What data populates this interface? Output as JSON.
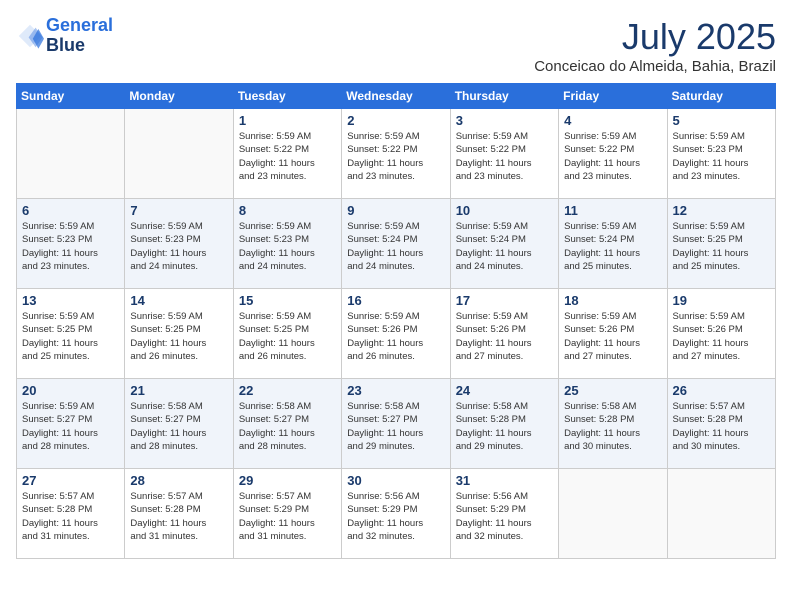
{
  "header": {
    "logo_line1": "General",
    "logo_line2": "Blue",
    "month": "July 2025",
    "location": "Conceicao do Almeida, Bahia, Brazil"
  },
  "days_of_week": [
    "Sunday",
    "Monday",
    "Tuesday",
    "Wednesday",
    "Thursday",
    "Friday",
    "Saturday"
  ],
  "weeks": [
    [
      {
        "num": "",
        "info": ""
      },
      {
        "num": "",
        "info": ""
      },
      {
        "num": "1",
        "info": "Sunrise: 5:59 AM\nSunset: 5:22 PM\nDaylight: 11 hours\nand 23 minutes."
      },
      {
        "num": "2",
        "info": "Sunrise: 5:59 AM\nSunset: 5:22 PM\nDaylight: 11 hours\nand 23 minutes."
      },
      {
        "num": "3",
        "info": "Sunrise: 5:59 AM\nSunset: 5:22 PM\nDaylight: 11 hours\nand 23 minutes."
      },
      {
        "num": "4",
        "info": "Sunrise: 5:59 AM\nSunset: 5:22 PM\nDaylight: 11 hours\nand 23 minutes."
      },
      {
        "num": "5",
        "info": "Sunrise: 5:59 AM\nSunset: 5:23 PM\nDaylight: 11 hours\nand 23 minutes."
      }
    ],
    [
      {
        "num": "6",
        "info": "Sunrise: 5:59 AM\nSunset: 5:23 PM\nDaylight: 11 hours\nand 23 minutes."
      },
      {
        "num": "7",
        "info": "Sunrise: 5:59 AM\nSunset: 5:23 PM\nDaylight: 11 hours\nand 24 minutes."
      },
      {
        "num": "8",
        "info": "Sunrise: 5:59 AM\nSunset: 5:23 PM\nDaylight: 11 hours\nand 24 minutes."
      },
      {
        "num": "9",
        "info": "Sunrise: 5:59 AM\nSunset: 5:24 PM\nDaylight: 11 hours\nand 24 minutes."
      },
      {
        "num": "10",
        "info": "Sunrise: 5:59 AM\nSunset: 5:24 PM\nDaylight: 11 hours\nand 24 minutes."
      },
      {
        "num": "11",
        "info": "Sunrise: 5:59 AM\nSunset: 5:24 PM\nDaylight: 11 hours\nand 25 minutes."
      },
      {
        "num": "12",
        "info": "Sunrise: 5:59 AM\nSunset: 5:25 PM\nDaylight: 11 hours\nand 25 minutes."
      }
    ],
    [
      {
        "num": "13",
        "info": "Sunrise: 5:59 AM\nSunset: 5:25 PM\nDaylight: 11 hours\nand 25 minutes."
      },
      {
        "num": "14",
        "info": "Sunrise: 5:59 AM\nSunset: 5:25 PM\nDaylight: 11 hours\nand 26 minutes."
      },
      {
        "num": "15",
        "info": "Sunrise: 5:59 AM\nSunset: 5:25 PM\nDaylight: 11 hours\nand 26 minutes."
      },
      {
        "num": "16",
        "info": "Sunrise: 5:59 AM\nSunset: 5:26 PM\nDaylight: 11 hours\nand 26 minutes."
      },
      {
        "num": "17",
        "info": "Sunrise: 5:59 AM\nSunset: 5:26 PM\nDaylight: 11 hours\nand 27 minutes."
      },
      {
        "num": "18",
        "info": "Sunrise: 5:59 AM\nSunset: 5:26 PM\nDaylight: 11 hours\nand 27 minutes."
      },
      {
        "num": "19",
        "info": "Sunrise: 5:59 AM\nSunset: 5:26 PM\nDaylight: 11 hours\nand 27 minutes."
      }
    ],
    [
      {
        "num": "20",
        "info": "Sunrise: 5:59 AM\nSunset: 5:27 PM\nDaylight: 11 hours\nand 28 minutes."
      },
      {
        "num": "21",
        "info": "Sunrise: 5:58 AM\nSunset: 5:27 PM\nDaylight: 11 hours\nand 28 minutes."
      },
      {
        "num": "22",
        "info": "Sunrise: 5:58 AM\nSunset: 5:27 PM\nDaylight: 11 hours\nand 28 minutes."
      },
      {
        "num": "23",
        "info": "Sunrise: 5:58 AM\nSunset: 5:27 PM\nDaylight: 11 hours\nand 29 minutes."
      },
      {
        "num": "24",
        "info": "Sunrise: 5:58 AM\nSunset: 5:28 PM\nDaylight: 11 hours\nand 29 minutes."
      },
      {
        "num": "25",
        "info": "Sunrise: 5:58 AM\nSunset: 5:28 PM\nDaylight: 11 hours\nand 30 minutes."
      },
      {
        "num": "26",
        "info": "Sunrise: 5:57 AM\nSunset: 5:28 PM\nDaylight: 11 hours\nand 30 minutes."
      }
    ],
    [
      {
        "num": "27",
        "info": "Sunrise: 5:57 AM\nSunset: 5:28 PM\nDaylight: 11 hours\nand 31 minutes."
      },
      {
        "num": "28",
        "info": "Sunrise: 5:57 AM\nSunset: 5:28 PM\nDaylight: 11 hours\nand 31 minutes."
      },
      {
        "num": "29",
        "info": "Sunrise: 5:57 AM\nSunset: 5:29 PM\nDaylight: 11 hours\nand 31 minutes."
      },
      {
        "num": "30",
        "info": "Sunrise: 5:56 AM\nSunset: 5:29 PM\nDaylight: 11 hours\nand 32 minutes."
      },
      {
        "num": "31",
        "info": "Sunrise: 5:56 AM\nSunset: 5:29 PM\nDaylight: 11 hours\nand 32 minutes."
      },
      {
        "num": "",
        "info": ""
      },
      {
        "num": "",
        "info": ""
      }
    ]
  ]
}
